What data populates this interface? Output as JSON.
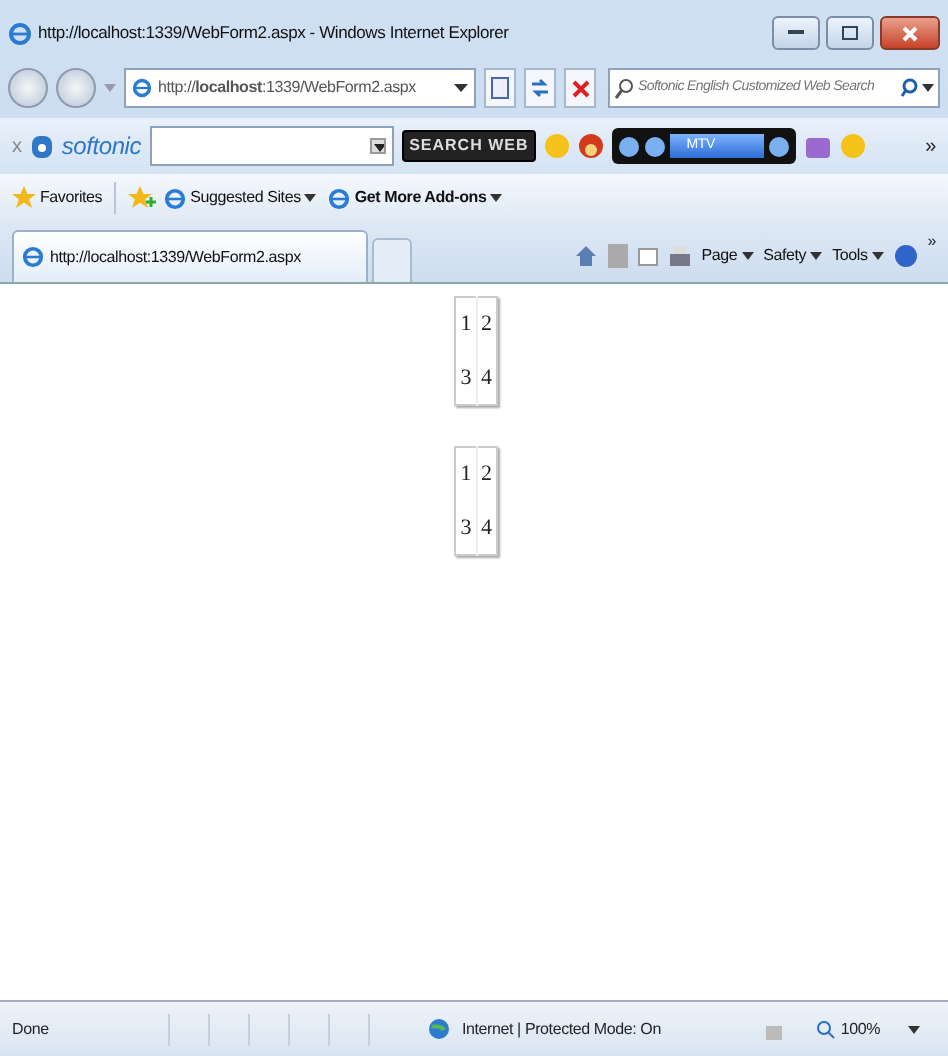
{
  "window": {
    "title": "http://localhost:1339/WebForm2.aspx - Windows Internet Explorer"
  },
  "address_bar": {
    "url": "http://**localhost**:1339/WebForm2.aspx"
  },
  "search": {
    "placeholder": "Softonic English Customized Web Search"
  },
  "softonic_toolbar": {
    "close": "x",
    "logo": "softonic",
    "search_button": "SEARCH WEB",
    "player_station": "MTV",
    "more": "»"
  },
  "favorites_bar": {
    "favorites": "Favorites",
    "links": [
      {
        "label": "Suggested Sites",
        "bold": false
      },
      {
        "label": "Get More Add-ons",
        "bold": true
      }
    ]
  },
  "tabs": [
    {
      "label": "http://localhost:1339/WebForm2.aspx",
      "selected": true
    }
  ],
  "command_bar": {
    "menus": [
      "Page",
      "Safety",
      "Tools"
    ],
    "more": "»"
  },
  "tables": [
    {
      "rows": [
        [
          "1",
          "2"
        ],
        [
          "3",
          "4"
        ]
      ]
    },
    {
      "rows": [
        [
          "1",
          "2"
        ],
        [
          "3",
          "4"
        ]
      ]
    }
  ],
  "status_bar": {
    "text": "Done",
    "zone": "Internet | Protected Mode: On",
    "zoom": "100%"
  }
}
